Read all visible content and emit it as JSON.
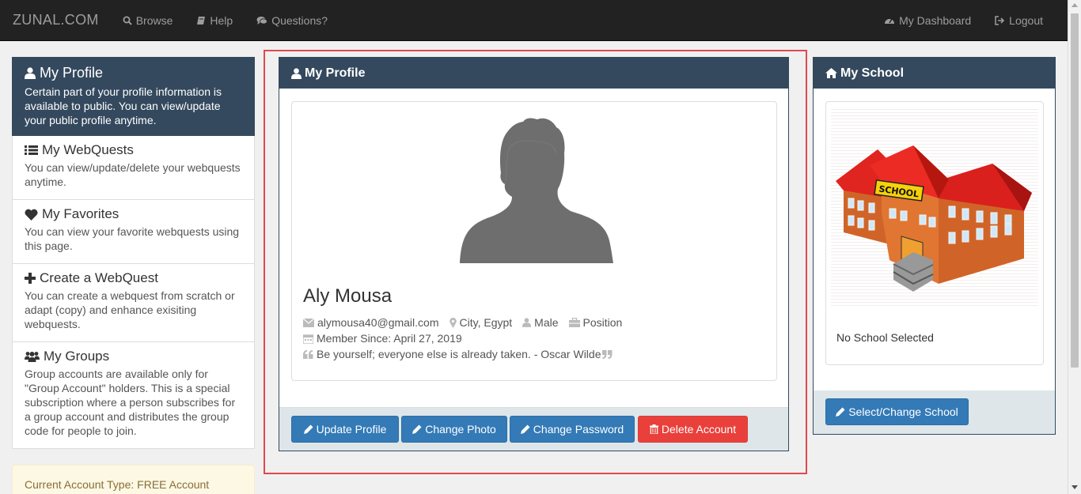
{
  "navbar": {
    "brand": "ZUNAL.COM",
    "browse": "Browse",
    "help": "Help",
    "questions": "Questions?",
    "dashboard": "My Dashboard",
    "logout": "Logout"
  },
  "sidebar": {
    "items": [
      {
        "title": "My Profile",
        "desc": "Certain part of your profile information is available to public. You can view/update your public profile anytime.",
        "icon": "user-icon",
        "active": true
      },
      {
        "title": "My WebQuests",
        "desc": "You can view/update/delete your webquests anytime.",
        "icon": "list-icon"
      },
      {
        "title": "My Favorites",
        "desc": "You can view your favorite webquests using this page.",
        "icon": "heart-icon"
      },
      {
        "title": "Create a WebQuest",
        "desc": "You can create a webquest from scratch or adapt (copy) and enhance exisiting webquests.",
        "icon": "plus-icon"
      },
      {
        "title": "My Groups",
        "desc": "Group accounts are available only for \"Group Account\" holders. This is a special subscription where a person subscribes for a group account and distributes the group code for people to join.",
        "icon": "users-icon"
      }
    ],
    "account_type": "Current Account Type: FREE Account"
  },
  "profile": {
    "panel_title": "My Profile",
    "name": "Aly Mousa",
    "email": "alymousa40@gmail.com",
    "location": "City, Egypt",
    "gender": "Male",
    "position": "Position",
    "member_since": "Member Since: April 27, 2019",
    "quote": "Be yourself; everyone else is already taken. - Oscar Wilde",
    "buttons": {
      "update": "Update Profile",
      "photo": "Change Photo",
      "password": "Change Password",
      "delete": "Delete Account"
    }
  },
  "school": {
    "panel_title": "My School",
    "sign": "SCHOOL",
    "caption": "No School Selected",
    "button": "Select/Change School"
  },
  "colors": {
    "navbar": "#222222",
    "panel_header": "#34495e",
    "primary": "#337ab7",
    "danger": "#e9403b",
    "highlight": "#e0484e"
  }
}
